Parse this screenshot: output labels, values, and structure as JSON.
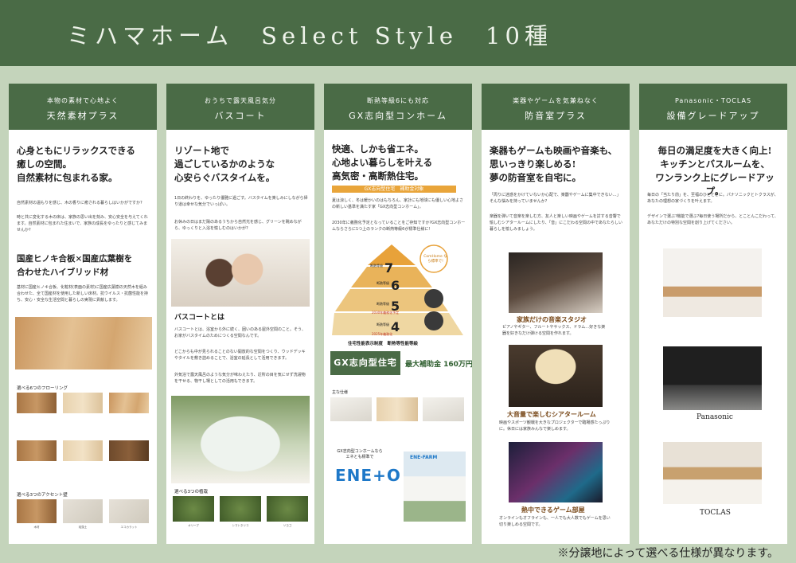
{
  "title": "ミハマホーム　Select Style　10種",
  "footnote": "※分譲地によって選べる仕様が異なります。",
  "panels": [
    {
      "sub": "本物の素材で心地よく",
      "main": "天然素材プラス",
      "headline": "心身ともにリラックスできる\n癒しの空間。\n自然素材に包まれる家。",
      "body1": "自然素材の温もりを感じ、木の香りに癒される暮らしはいかがですか?",
      "body2": "時と共に変化する木の床は、家族の思い出を刻み、安心安全を与えてくれます。自然素材に包まれた住まいで、家族の成長をゆったりと感じてみませんか?",
      "sub_headline": "国産ヒノキ合板×国産広葉樹を\n合わせたハイブリッド材",
      "body3": "基材に国産ヒノキ合板、化粧材(表面の素材)に国産広葉樹の天然木を組み合わせた、全て国産材を使用した新しい床材。抗ウイルス・抗菌性能を持ち、安心・安全な生活空間と暮らしの実現に貢献します。",
      "flooring_label": "選べる6つのフローリング",
      "accent_label": "選べる3つのアクセント壁",
      "accent_items": [
        "木材",
        "珪藻土",
        "エコカラット"
      ]
    },
    {
      "sub": "おうちで露天風呂気分",
      "main": "バスコート",
      "headline": "リゾート地で\n過ごしているかのような\n心安らぐバスタイムを。",
      "body1": "1日の終わりを、ゆったり優雅に過ごす。バスタイムを楽しみにしながら帰り道は幸せな気分でいっぱい。",
      "body2": "お休みの日はまだ陽のあるうちから自然光を感じ、グリーンを眺めながら、ゆっくりと入浴を愉しむのはいかが?",
      "sub_headline": "バスコートとは",
      "body3": "バスコートとは、浴室から外に続く、囲いのある屋外空間のこと。そう、お家がバスタイムのためにつくる空間なんです。",
      "body4": "どこからも中が見られることのない開放的な空間をつくり、ウッドデッキやタイルを敷き詰めることで、浴室の延長として活用できます。",
      "body5": "外気浴で露天風呂のような気分が味わえたり、近所の目を気にせず洗濯物を干せる、物干し場としての活用もできます。",
      "plant_label": "選べる3つの植栽",
      "plant_items": [
        "オリーブ",
        "シマトネリコ",
        "ソヨゴ"
      ]
    },
    {
      "sub": "断熱等級6にも対応",
      "main": "GX志向型コンホーム",
      "headline": "快適、しかも省エネ。\n心地よい暮らしを叶える\n高気密・高断熱住宅。",
      "orange_bar": "GX志向型住宅　補助金対象",
      "body1": "夏は涼しく、冬は暖かいのはもちろん、家計にも地球にも優しい心地よさの新しい基準を満たす家「GX志向型コンホーム」。",
      "body2": "2030年に義務化予定となっていることをご存知ですか?GX志向型コンホームならさらに1つ上のランクの断熱等級6が標準仕様に!",
      "levels": [
        "7",
        "6",
        "5",
        "4"
      ],
      "level_text": "断熱等級",
      "note1": "2030年義務化予定",
      "note2": "2025年義務化",
      "bubble": "ComHome なら標準で!",
      "chart_caption": "住宅性能表示制度　断熱等性能等級",
      "badge": "GX志向型住宅",
      "subsidy": "最大補助金 160万円",
      "spec_label": "主な仕様",
      "eneto_head": "GX志向型コンホームなら\nエネとも標準で",
      "eneto": "ENE+O",
      "enefarm": "ENE-FARM"
    },
    {
      "sub": "楽器やゲームを気兼ねなく",
      "main": "防音室プラス",
      "headline": "楽器もゲームも映画や音楽も、\n思いっきり楽しめる!\n夢の防音室を自宅に。",
      "body1": "「周りに迷惑をかけていないか心配で、楽器やゲームに集中できない…」そんな悩みを持っていませんか?",
      "body2": "楽器を弾いて音楽を楽しむ方、友人と楽しい映画やゲームを討する音響で愉しむシアタールームにしたり、「音」にこだわる空間の中であなたらしい暮らしを愉しみましょう。",
      "cap1": "家族だけの音楽スタジオ",
      "cap1_body": "ピアノやギター、フルートやサックス、ドラム…好きな楽器を好きなだけ弾ける空間を作れます。",
      "cap2": "大音量で楽しむシアタールーム",
      "cap2_body": "映画やスポーツ観戦を大きなプロジェクターで臨場感たっぷりに。休日には家族みんなで楽しめます。",
      "cap3": "熱中できるゲーム部屋",
      "cap3_body": "オンラインもオフラインも、一人でも大人数でもゲームを思い切り楽しめる空間です。"
    },
    {
      "sub": "Panasonic・TOCLAS",
      "main": "設備グレードアップ",
      "headline": "毎日の満足度を大きく向上!\nキッチンとバスルームを、\nワンランク上にグレードアップ。",
      "body1": "毎日の「当たり前」を、至福のひとときに。パナソニックとトクラスが、あなたの理想の家づくりを叶えます。",
      "body2": "デザインで選ぶ?機能で選ぶ?毎日使う場所だから、とことんこだわって、あなただけの特別な空間を創り上げてください。",
      "label1": "Panasonic",
      "label2": "TOCLAS"
    }
  ]
}
